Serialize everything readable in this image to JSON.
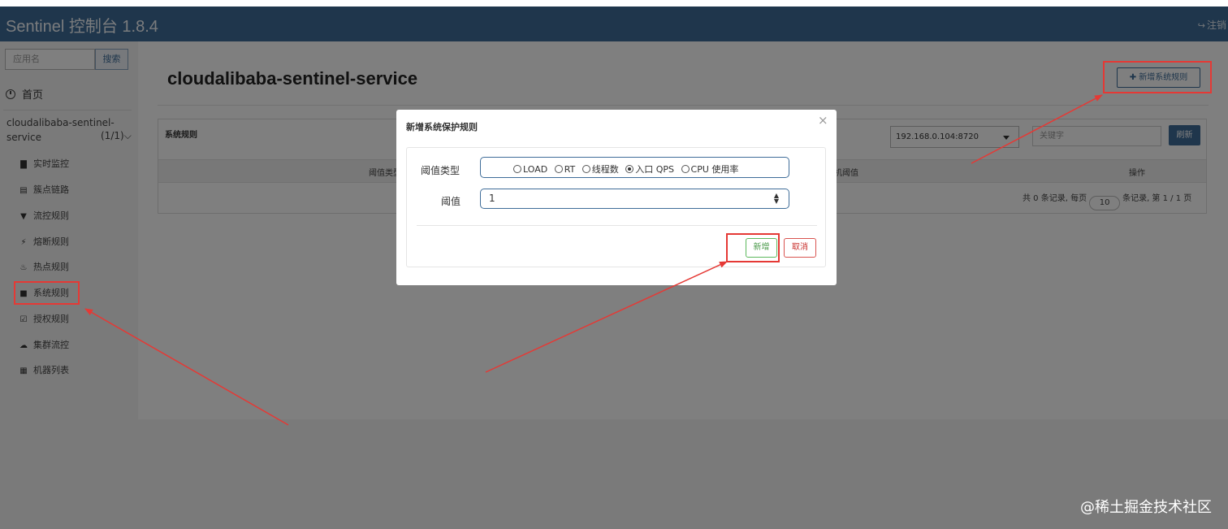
{
  "header": {
    "brand": "Sentinel 控制台 1.8.4",
    "logout_label": "注销"
  },
  "sidebar": {
    "search_placeholder": "应用名",
    "search_button": "搜索",
    "home_label": "首页",
    "app_name": "cloudalibaba-sentinel-service",
    "app_count": "(1/1)",
    "items": [
      {
        "label": "实时监控",
        "icon": "bar-chart-icon"
      },
      {
        "label": "簇点链路",
        "icon": "list-icon"
      },
      {
        "label": "流控规则",
        "icon": "filter-icon"
      },
      {
        "label": "熔断规则",
        "icon": "bolt-icon"
      },
      {
        "label": "热点规则",
        "icon": "fire-icon"
      },
      {
        "label": "系统规则",
        "icon": "lock-icon"
      },
      {
        "label": "授权规则",
        "icon": "check-square-icon"
      },
      {
        "label": "集群流控",
        "icon": "cloud-icon"
      },
      {
        "label": "机器列表",
        "icon": "table-icon"
      }
    ]
  },
  "main": {
    "page_title": "cloudalibaba-sentinel-service",
    "add_rule_button": "新增系统规则",
    "panel_title": "系统规则",
    "machine_select": "192.168.0.104:8720",
    "keyword_placeholder": "关键字",
    "refresh_button": "刷新",
    "columns": {
      "threshold_type": "阈值类型",
      "machine_threshold": "机阈值",
      "actions": "操作"
    },
    "pager": {
      "prefix": "共 0 条记录, 每页",
      "page_size": "10",
      "suffix": "条记录, 第 1 / 1 页"
    }
  },
  "modal": {
    "title": "新增系统保护规则",
    "threshold_type_label": "阈值类型",
    "options": [
      "LOAD",
      "RT",
      "线程数",
      "入口 QPS",
      "CPU 使用率"
    ],
    "selected_option": "入口 QPS",
    "threshold_label": "阈值",
    "threshold_value": "1",
    "add_button": "新增",
    "cancel_button": "取消"
  },
  "watermark": "@稀土掘金技术社区",
  "colors": {
    "navbar": "#3f6d99",
    "accent": "#3f6d99",
    "annotation": "#e53935",
    "success": "#5cb85c",
    "danger": "#d9534f"
  }
}
